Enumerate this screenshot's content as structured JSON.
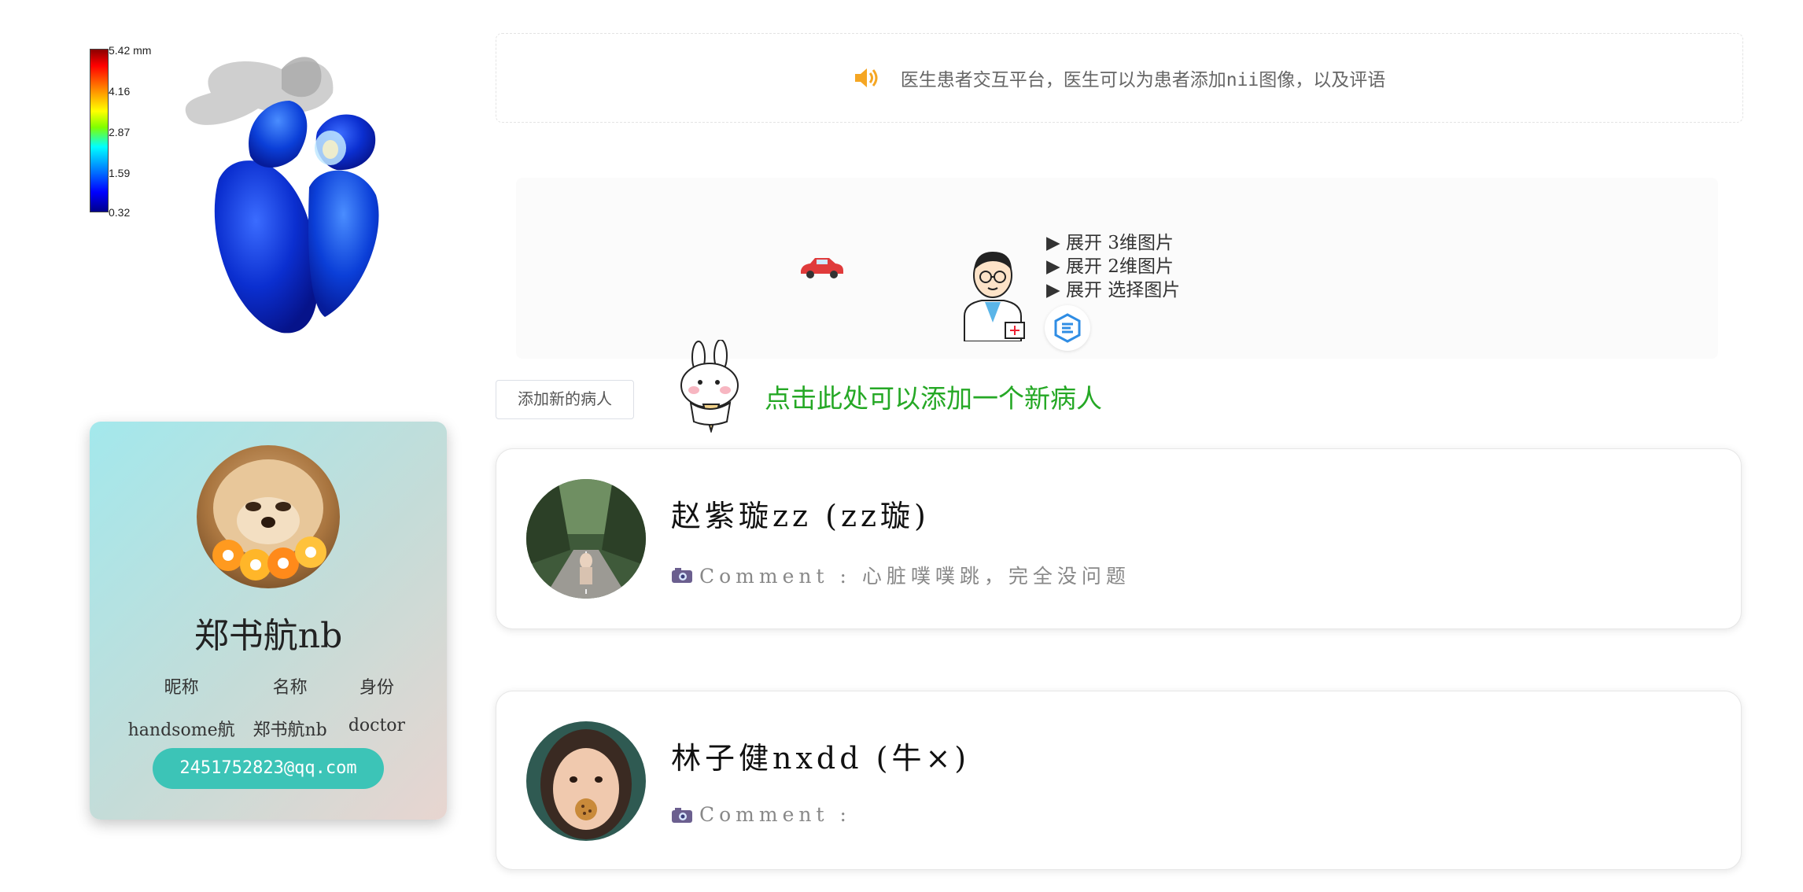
{
  "colorbar": {
    "labels": [
      "5.42 mm",
      "4.16",
      "2.87",
      "1.59",
      "0.32"
    ]
  },
  "profile": {
    "name": "郑书航nb",
    "headers": [
      "昵称",
      "名称",
      "身份"
    ],
    "values": [
      "handsome航",
      "郑书航nb",
      "doctor"
    ],
    "email": "2451752823@qq.com"
  },
  "notice": {
    "text": "医生患者交互平台，医生可以为患者添加nii图像，以及评语"
  },
  "expand": {
    "items": [
      "▶ 展开 3维图片",
      "▶ 展开 2维图片",
      "▶ 展开 选择图片"
    ]
  },
  "add_patient": {
    "button_label": "添加新的病人",
    "hint": "点击此处可以添加一个新病人"
  },
  "patients": [
    {
      "name": "赵紫璇zz (zz璇)",
      "comment": "Comment : 心脏噗噗跳，完全没问题"
    },
    {
      "name": "林子健nxdd (牛×)",
      "comment": "Comment :"
    }
  ],
  "colors": {
    "accent_teal": "#3cc4b7",
    "hint_green": "#25a825",
    "speaker_orange": "#f5a623"
  }
}
